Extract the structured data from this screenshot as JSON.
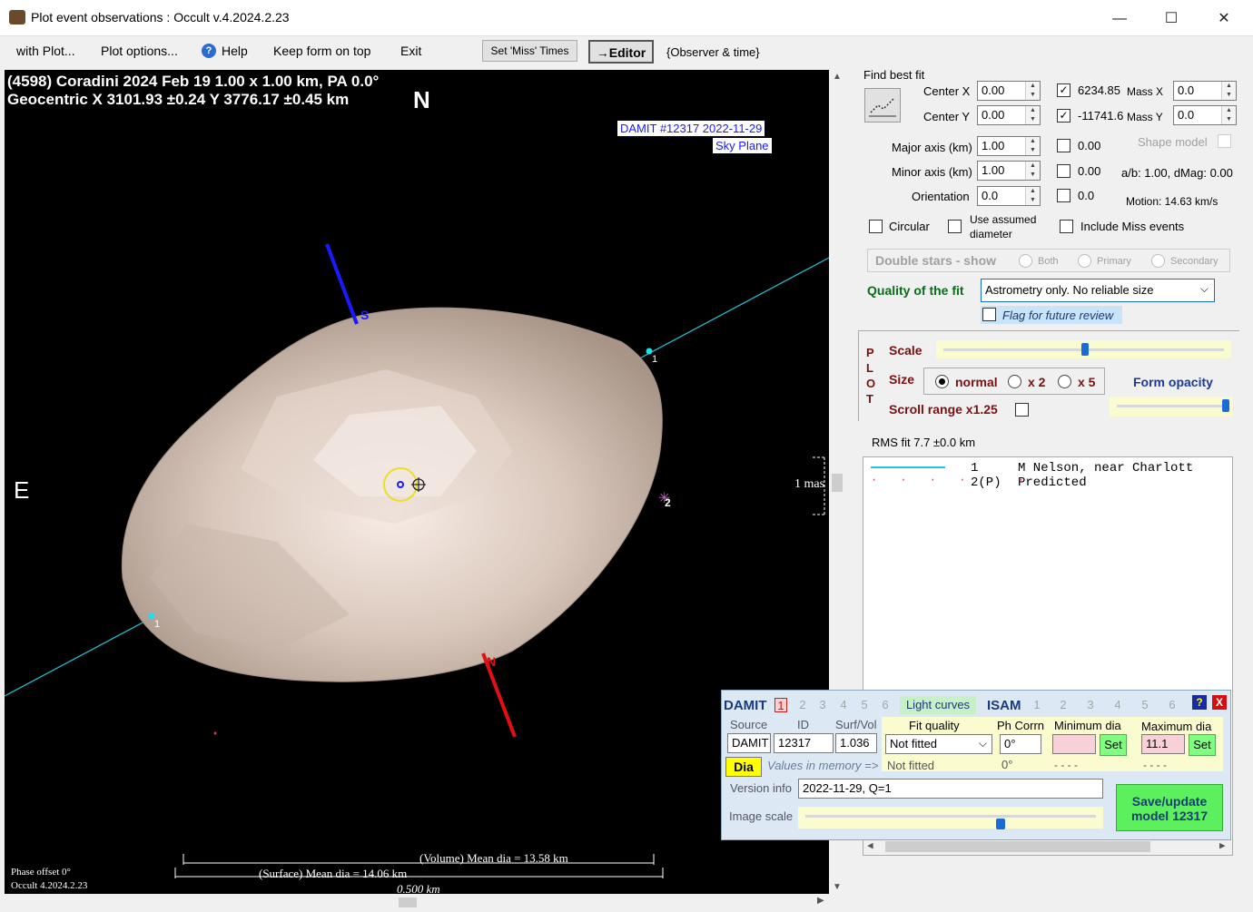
{
  "window": {
    "title": "Plot event observations : Occult v.4.2024.2.23",
    "minimize": "—",
    "maximize": "☐",
    "close": "✕"
  },
  "menu": {
    "with_plot": "with Plot...",
    "plot_options": "Plot options...",
    "help": "Help",
    "keep_on_top": "Keep form on top",
    "exit": "Exit",
    "set_miss": "Set 'Miss' Times",
    "editor": "→Editor",
    "observer": "{Observer & time}"
  },
  "plot": {
    "header_line1": "(4598) Coradini  2024 Feb 19   1.00 x 1.00 km, PA 0.0°",
    "header_line2": "Geocentric  X  3101.93 ±0.24  Y 3776.17 ±0.45 km",
    "north": "N",
    "east": "E",
    "damit_label_1": "DAMIT #12317 2022-11-29",
    "damit_label_2": "Sky Plane",
    "pole_s": "S",
    "pole_n": "N",
    "chord_1a": "1",
    "chord_1b": "1",
    "star_2": "2",
    "mas": "1 mas",
    "volume_dia": "(Volume) Mean dia = 13.58 km",
    "surface_dia": "(Surface) Mean dia = 14.06 km",
    "scale_km": "0.500 km",
    "phase_offset": "Phase offset 0°",
    "occult_version": "Occult 4.2024.2.23"
  },
  "fit": {
    "find_best_fit": "Find best fit",
    "center_x_label": "Center X",
    "center_x": "0.00",
    "center_y_label": "Center Y",
    "center_y": "0.00",
    "mass_x_val": "6234.85",
    "mass_x_label": "Mass X",
    "mass_x": "0.0",
    "mass_y_val": "-11741.6",
    "mass_y_label": "Mass Y",
    "mass_y": "0.0",
    "major_label": "Major axis (km)",
    "major": "1.00",
    "major_chk": "0.00",
    "minor_label": "Minor axis (km)",
    "minor": "1.00",
    "minor_chk": "0.00",
    "orient_label": "Orientation",
    "orient": "0.0",
    "orient_chk": "0.0",
    "shape_model": "Shape model",
    "ab_dmag": "a/b: 1.00, dMag: 0.00",
    "motion": "Motion: 14.63 km/s",
    "circular": "Circular",
    "use_assumed_1": "Use assumed",
    "use_assumed_2": "diameter",
    "include_miss": "Include Miss events",
    "double_stars": "Double stars - show",
    "both": "Both",
    "primary": "Primary",
    "secondary": "Secondary",
    "quality_label": "Quality of the fit",
    "quality_value": "Astrometry only. No reliable size",
    "flag_review": "Flag for future review"
  },
  "plotbox": {
    "p": "P",
    "l": "L",
    "o": "O",
    "t": "T",
    "scale": "Scale",
    "size": "Size",
    "normal": "normal",
    "x2": "x 2",
    "x5": "x 5",
    "form_opacity": "Form opacity",
    "scroll_range": "Scroll range x1.25"
  },
  "rms": "RMS fit  7.7 ±0.0 km",
  "legend": [
    {
      "num": "1",
      "text": "M Nelson, near Charlott"
    },
    {
      "num": "2(P)",
      "text": "Predicted"
    }
  ],
  "damit": {
    "damit": "DAMIT",
    "tabs": [
      "1",
      "2",
      "3",
      "4",
      "5",
      "6"
    ],
    "light_curves": "Light curves",
    "isam": "ISAM",
    "isam_tabs": [
      "1",
      "2",
      "3",
      "4",
      "5",
      "6"
    ],
    "help": "?",
    "close": "X",
    "source_h": "Source",
    "id_h": "ID",
    "surfvol_h": "Surf/Vol",
    "fitq_h": "Fit quality",
    "phcorr_h": "Ph Corrn",
    "min_h": "Minimum dia",
    "max_h": "Maximum dia",
    "source": "DAMIT",
    "id": "12317",
    "surfvol": "1.036",
    "fitq": "Not fitted",
    "phcorr": "0°",
    "min": "",
    "max": "11.1",
    "set": "Set",
    "dia": "Dia",
    "values_mem": "Values in memory =>",
    "mem_fitq": "Not fitted",
    "mem_ph": "0°",
    "mem_min": "- - - -",
    "mem_max": "- - - -",
    "version_label": "Version info",
    "version": "2022-11-29, Q=1",
    "image_scale": "Image scale",
    "save_1": "Save/update",
    "save_2": "model  12317"
  }
}
